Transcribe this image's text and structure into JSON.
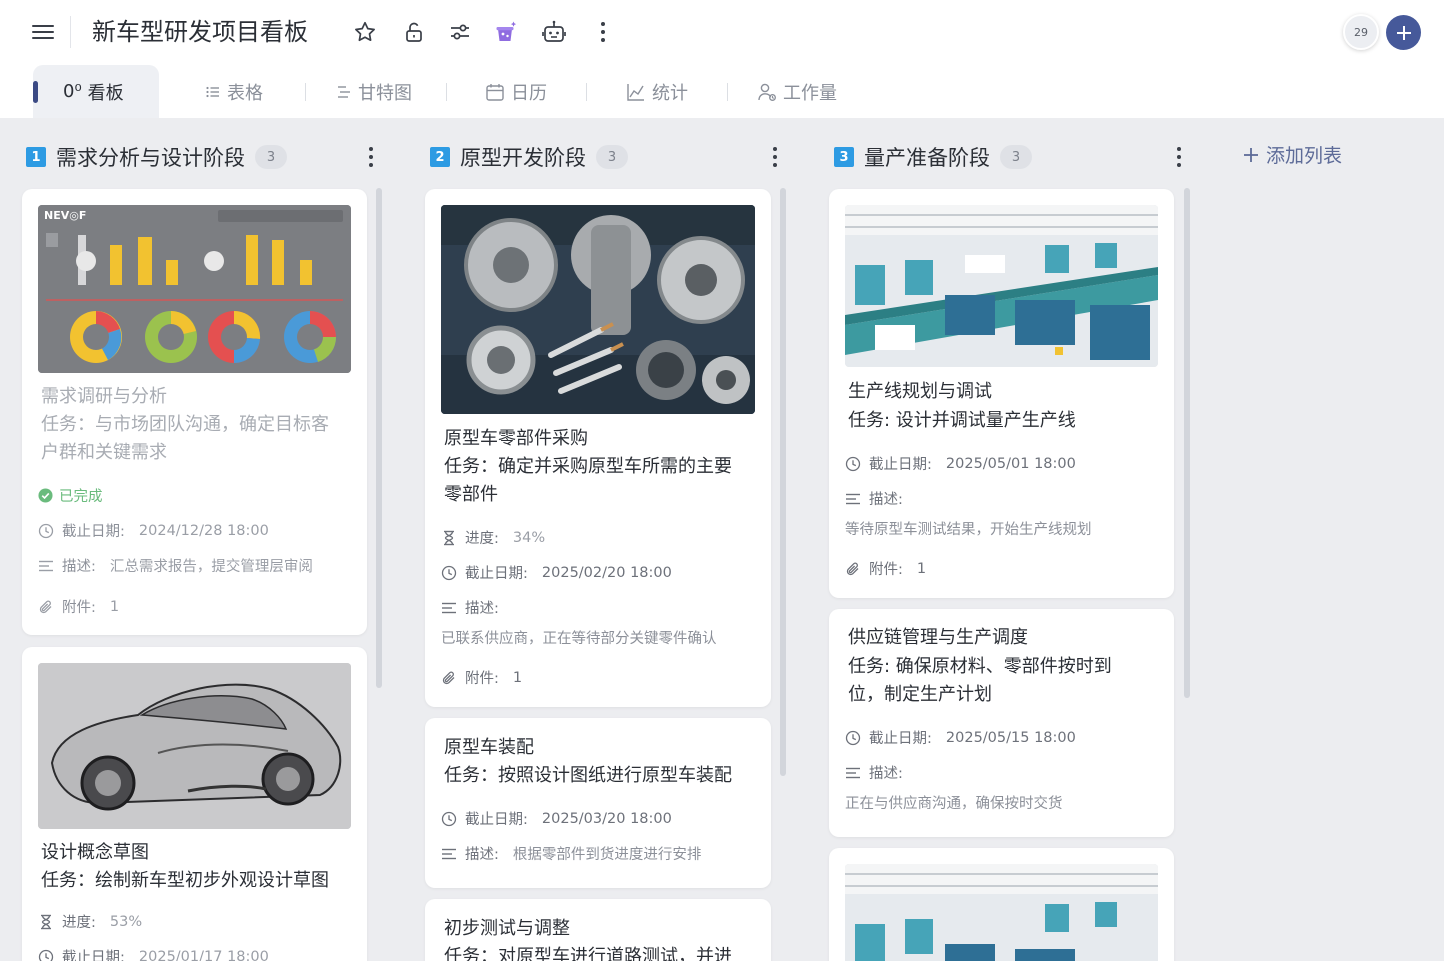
{
  "header": {
    "title": "新车型研发项目看板",
    "member_count": "29",
    "icons": [
      "menu-icon",
      "star-icon",
      "unlock-icon",
      "filter-sliders-icon",
      "magic-hat-icon",
      "robot-icon",
      "more-vertical-icon",
      "plus-icon"
    ]
  },
  "tabs": [
    {
      "label": "看板",
      "icon": "kanban-icon"
    },
    {
      "label": "表格",
      "icon": "list-icon"
    },
    {
      "label": "甘特图",
      "icon": "gantt-icon"
    },
    {
      "label": "日历",
      "icon": "calendar-icon"
    },
    {
      "label": "统计",
      "icon": "chart-icon"
    },
    {
      "label": "工作量",
      "icon": "workload-icon"
    }
  ],
  "add_list_label": "添加列表",
  "labels": {
    "progress": "进度:",
    "deadline": "截止日期:",
    "description": "描述:",
    "attachments": "附件:",
    "completed": "已完成"
  },
  "columns": [
    {
      "number": "1",
      "title": "需求分析与设计阶段",
      "count": "3",
      "cards": [
        {
          "title": "需求调研与分析",
          "task_line1": "任务：与市场团队沟通，确定目标客",
          "task_line2": "户群和关键需求",
          "status": "已完成",
          "deadline": "2024/12/28 18:00",
          "description": "汇总需求报告，提交管理层审阅",
          "attachments": "1",
          "image": "infographic-charts"
        },
        {
          "title": "设计概念草图",
          "task_line1": "任务：绘制新车型初步外观设计草图",
          "progress": "53%",
          "deadline": "2025/01/17 18:00",
          "image": "car-sketch"
        }
      ]
    },
    {
      "number": "2",
      "title": "原型开发阶段",
      "count": "3",
      "cards": [
        {
          "title": "原型车零部件采购",
          "task_line1": "任务：确定并采购原型车所需的主要",
          "task_line2": "零部件",
          "progress": "34%",
          "deadline": "2025/02/20 18:00",
          "description": "已联系供应商，正在等待部分关键零件确认",
          "attachments": "1",
          "image": "auto-parts"
        },
        {
          "title": "原型车装配",
          "task_line1": "任务：按照设计图纸进行原型车装配",
          "deadline": "2025/03/20 18:00",
          "description": "根据零部件到货进度进行安排"
        },
        {
          "title": "初步测试与调整",
          "task_line1": "任务：对原型车进行道路测试，并进"
        }
      ]
    },
    {
      "number": "3",
      "title": "量产准备阶段",
      "count": "3",
      "cards": [
        {
          "title": "生产线规划与调试",
          "task_line1": "任务: 设计并调试量产生产线",
          "deadline": "2025/05/01 18:00",
          "description": "等待原型车测试结果，开始生产线规划",
          "attachments": "1",
          "image": "factory-line"
        },
        {
          "title": "供应链管理与生产调度",
          "task_line1": "任务: 确保原材料、零部件按时到",
          "task_line2": "位，制定生产计划",
          "deadline": "2025/05/15 18:00",
          "description": "正在与供应商沟通，确保按时交货"
        },
        {
          "image": "factory-line"
        }
      ]
    }
  ],
  "colors": {
    "accent": "#46599a",
    "column_number": "#2d9be3",
    "done_green": "#6abb7d"
  }
}
